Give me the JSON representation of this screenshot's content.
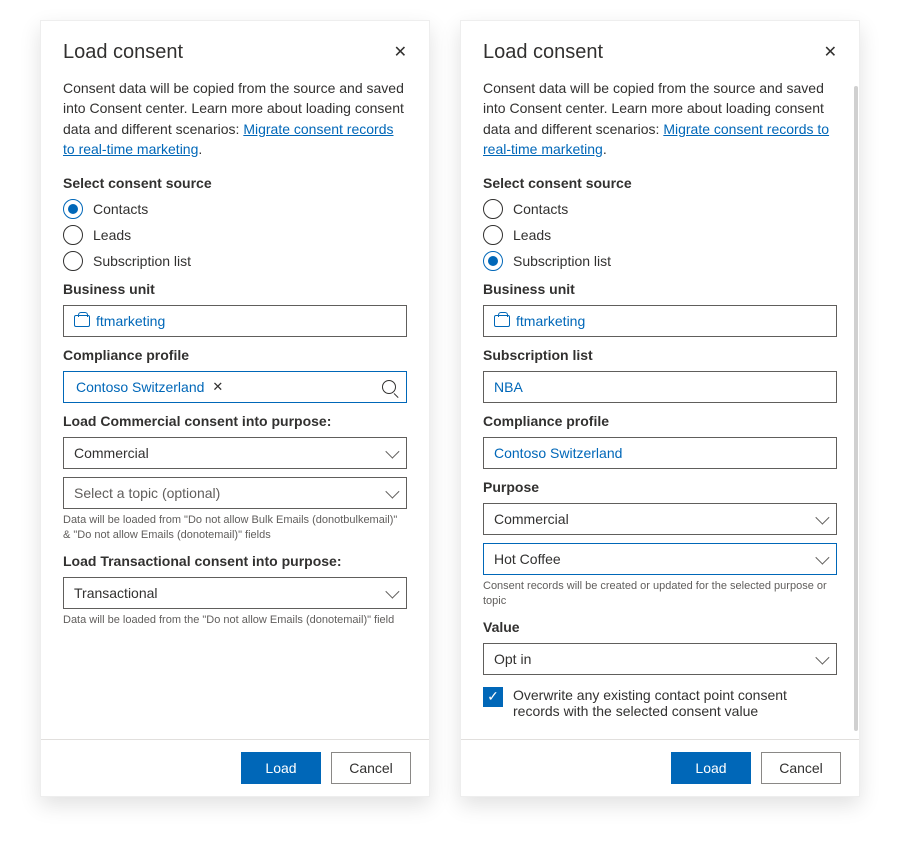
{
  "left": {
    "title": "Load consent",
    "intro_pre": "Consent data will be copied from the source and saved into Consent center. Learn more about loading consent data and different scenarios: ",
    "intro_link": "Migrate consent records to real-time marketing",
    "intro_post": ".",
    "source_label": "Select consent source",
    "radios": {
      "contacts": "Contacts",
      "leads": "Leads",
      "sublist": "Subscription list"
    },
    "selected_radio": "contacts",
    "bu_label": "Business unit",
    "bu_value": "ftmarketing",
    "cp_label": "Compliance profile",
    "cp_value": "Contoso Switzerland",
    "comm_label": "Load Commercial consent into purpose:",
    "comm_value": "Commercial",
    "comm_topic_placeholder": "Select a topic (optional)",
    "comm_helper": "Data will be loaded from \"Do not allow Bulk Emails (donotbulkemail)\" & \"Do not allow Emails (donotemail)\" fields",
    "trans_label": "Load Transactional consent into purpose:",
    "trans_value": "Transactional",
    "trans_helper": "Data will be loaded from the \"Do not allow Emails (donotemail)\" field",
    "load_btn": "Load",
    "cancel_btn": "Cancel"
  },
  "right": {
    "title": "Load consent",
    "intro_pre": "Consent data will be copied from the source and saved into Consent center. Learn more about loading consent data and different scenarios: ",
    "intro_link": "Migrate consent records to real-time marketing",
    "intro_post": ".",
    "source_label": "Select consent source",
    "radios": {
      "contacts": "Contacts",
      "leads": "Leads",
      "sublist": "Subscription list"
    },
    "selected_radio": "sublist",
    "bu_label": "Business unit",
    "bu_value": "ftmarketing",
    "sublist_label": "Subscription list",
    "sublist_value": "NBA",
    "cp_label": "Compliance profile",
    "cp_value": "Contoso Switzerland",
    "purpose_label": "Purpose",
    "purpose_value": "Commercial",
    "topic_value": "Hot Coffee",
    "purpose_helper": "Consent records will be created or updated for the selected purpose or topic",
    "value_label": "Value",
    "value_value": "Opt in",
    "overwrite_label": "Overwrite any existing contact point consent records with the selected consent value",
    "load_btn": "Load",
    "cancel_btn": "Cancel"
  }
}
